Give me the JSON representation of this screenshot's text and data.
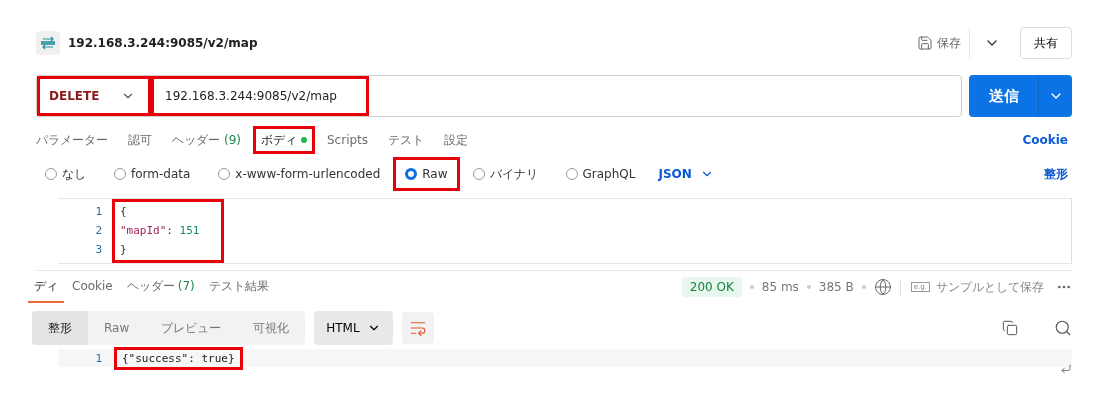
{
  "header": {
    "title": "192.168.3.244:9085/v2/map",
    "save": "保存",
    "share": "共有"
  },
  "request": {
    "method": "DELETE",
    "method_highlighted": true,
    "url": "192.168.3.244:9085/v2/map",
    "url_highlighted": true,
    "send": "送信"
  },
  "tabs": [
    {
      "label": "パラメーター",
      "selected": false,
      "highlighted": false
    },
    {
      "label": "認可",
      "selected": false,
      "highlighted": false
    },
    {
      "label": "ヘッダー",
      "count": "(9)",
      "selected": false,
      "highlighted": false
    },
    {
      "label": "ボディ",
      "dot": true,
      "selected": true,
      "highlighted": true
    },
    {
      "label": "Scripts",
      "selected": false,
      "highlighted": false
    },
    {
      "label": "テスト",
      "selected": false,
      "highlighted": false
    },
    {
      "label": "設定",
      "selected": false,
      "highlighted": false
    }
  ],
  "cookie_link": "Cookie",
  "body_types": [
    {
      "label": "なし",
      "selected": false,
      "highlighted": false
    },
    {
      "label": "form-data",
      "selected": false,
      "highlighted": false
    },
    {
      "label": "x-www-form-urlencoded",
      "selected": false,
      "highlighted": false
    },
    {
      "label": "Raw",
      "selected": true,
      "highlighted": true
    },
    {
      "label": "バイナリ",
      "selected": false,
      "highlighted": false
    },
    {
      "label": "GraphQL",
      "selected": false,
      "highlighted": false
    }
  ],
  "format": "JSON",
  "beautify": "整形",
  "request_body": {
    "highlighted": true,
    "lines": [
      {
        "number": "1",
        "tokens": [
          {
            "kind": "punct",
            "text": "{"
          }
        ]
      },
      {
        "number": "2",
        "tokens": [
          {
            "kind": "key",
            "text": "\"mapId\""
          },
          {
            "kind": "punct",
            "text": ": "
          },
          {
            "kind": "number",
            "text": "151"
          }
        ]
      },
      {
        "number": "3",
        "tokens": [
          {
            "kind": "punct",
            "text": "}"
          }
        ]
      }
    ]
  },
  "response_tabs": [
    {
      "label": "ディ",
      "selected": true
    },
    {
      "label": "Cookie",
      "selected": false
    },
    {
      "label": "ヘッダー",
      "count": "(7)",
      "selected": false
    },
    {
      "label": "テスト結果",
      "selected": false
    }
  ],
  "status": {
    "code": "200 OK",
    "time": "85 ms",
    "size": "385 B",
    "example_icon": "e.g.",
    "save_example": "サンプルとして保存"
  },
  "view_modes": [
    {
      "label": "整形",
      "selected": true
    },
    {
      "label": "Raw",
      "selected": false
    },
    {
      "label": "プレビュー",
      "selected": false
    },
    {
      "label": "可視化",
      "selected": false
    }
  ],
  "response_format": "HTML",
  "response_body": {
    "highlighted": true,
    "lines": [
      {
        "number": "1",
        "text": "{\"success\": true}"
      }
    ]
  }
}
